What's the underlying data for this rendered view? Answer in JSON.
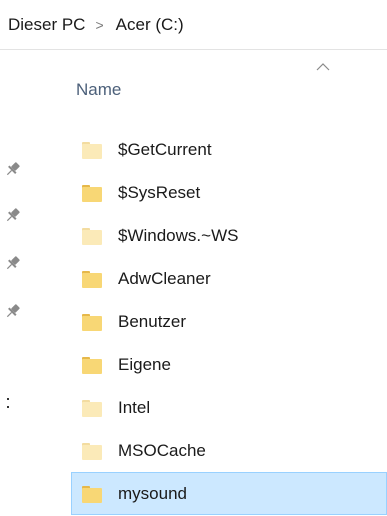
{
  "breadcrumb": {
    "items": [
      {
        "label": "Dieser PC"
      },
      {
        "label": "Acer (C:)"
      }
    ],
    "separator": ">"
  },
  "columns": {
    "name_label": "Name",
    "sort_direction": "ascending"
  },
  "quick_access": {
    "pin_icon": "pin-icon",
    "pin_count": 4
  },
  "files": [
    {
      "name": "$GetCurrent",
      "icon": "folder-icon",
      "style": "pale",
      "selected": false
    },
    {
      "name": "$SysReset",
      "icon": "folder-icon",
      "style": "normal",
      "selected": false
    },
    {
      "name": "$Windows.~WS",
      "icon": "folder-icon",
      "style": "pale",
      "selected": false
    },
    {
      "name": "AdwCleaner",
      "icon": "folder-icon",
      "style": "normal",
      "selected": false
    },
    {
      "name": "Benutzer",
      "icon": "folder-icon",
      "style": "normal",
      "selected": false
    },
    {
      "name": "Eigene",
      "icon": "folder-icon",
      "style": "normal",
      "selected": false
    },
    {
      "name": "Intel",
      "icon": "folder-icon",
      "style": "pale",
      "selected": false
    },
    {
      "name": "MSOCache",
      "icon": "folder-icon",
      "style": "pale",
      "selected": false
    },
    {
      "name": "mysound",
      "icon": "folder-icon",
      "style": "normal",
      "selected": true
    }
  ],
  "colors": {
    "folder": "#f8d775",
    "folder_tab": "#e6b84a",
    "folder_pale": "#fbeab8",
    "selection_bg": "#cce8ff",
    "selection_border": "#99d1ff",
    "header_text": "#4c607a"
  }
}
